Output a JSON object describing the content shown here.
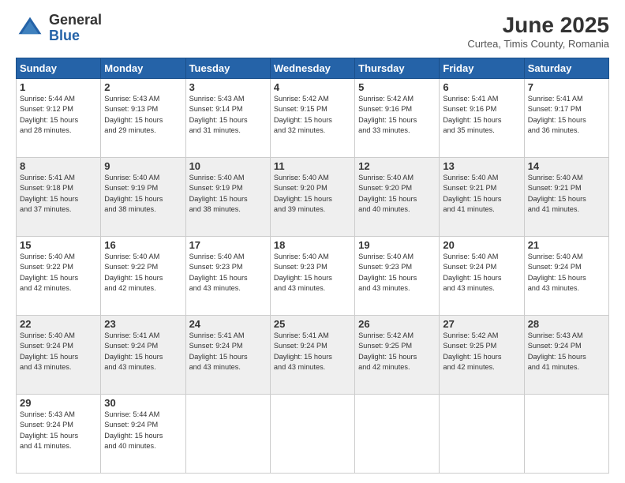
{
  "header": {
    "logo_general": "General",
    "logo_blue": "Blue",
    "month_title": "June 2025",
    "subtitle": "Curtea, Timis County, Romania"
  },
  "days_of_week": [
    "Sunday",
    "Monday",
    "Tuesday",
    "Wednesday",
    "Thursday",
    "Friday",
    "Saturday"
  ],
  "weeks": [
    [
      {
        "day": "1",
        "info": "Sunrise: 5:44 AM\nSunset: 9:12 PM\nDaylight: 15 hours\nand 28 minutes."
      },
      {
        "day": "2",
        "info": "Sunrise: 5:43 AM\nSunset: 9:13 PM\nDaylight: 15 hours\nand 29 minutes."
      },
      {
        "day": "3",
        "info": "Sunrise: 5:43 AM\nSunset: 9:14 PM\nDaylight: 15 hours\nand 31 minutes."
      },
      {
        "day": "4",
        "info": "Sunrise: 5:42 AM\nSunset: 9:15 PM\nDaylight: 15 hours\nand 32 minutes."
      },
      {
        "day": "5",
        "info": "Sunrise: 5:42 AM\nSunset: 9:16 PM\nDaylight: 15 hours\nand 33 minutes."
      },
      {
        "day": "6",
        "info": "Sunrise: 5:41 AM\nSunset: 9:16 PM\nDaylight: 15 hours\nand 35 minutes."
      },
      {
        "day": "7",
        "info": "Sunrise: 5:41 AM\nSunset: 9:17 PM\nDaylight: 15 hours\nand 36 minutes."
      }
    ],
    [
      {
        "day": "8",
        "info": "Sunrise: 5:41 AM\nSunset: 9:18 PM\nDaylight: 15 hours\nand 37 minutes."
      },
      {
        "day": "9",
        "info": "Sunrise: 5:40 AM\nSunset: 9:19 PM\nDaylight: 15 hours\nand 38 minutes."
      },
      {
        "day": "10",
        "info": "Sunrise: 5:40 AM\nSunset: 9:19 PM\nDaylight: 15 hours\nand 38 minutes."
      },
      {
        "day": "11",
        "info": "Sunrise: 5:40 AM\nSunset: 9:20 PM\nDaylight: 15 hours\nand 39 minutes."
      },
      {
        "day": "12",
        "info": "Sunrise: 5:40 AM\nSunset: 9:20 PM\nDaylight: 15 hours\nand 40 minutes."
      },
      {
        "day": "13",
        "info": "Sunrise: 5:40 AM\nSunset: 9:21 PM\nDaylight: 15 hours\nand 41 minutes."
      },
      {
        "day": "14",
        "info": "Sunrise: 5:40 AM\nSunset: 9:21 PM\nDaylight: 15 hours\nand 41 minutes."
      }
    ],
    [
      {
        "day": "15",
        "info": "Sunrise: 5:40 AM\nSunset: 9:22 PM\nDaylight: 15 hours\nand 42 minutes."
      },
      {
        "day": "16",
        "info": "Sunrise: 5:40 AM\nSunset: 9:22 PM\nDaylight: 15 hours\nand 42 minutes."
      },
      {
        "day": "17",
        "info": "Sunrise: 5:40 AM\nSunset: 9:23 PM\nDaylight: 15 hours\nand 43 minutes."
      },
      {
        "day": "18",
        "info": "Sunrise: 5:40 AM\nSunset: 9:23 PM\nDaylight: 15 hours\nand 43 minutes."
      },
      {
        "day": "19",
        "info": "Sunrise: 5:40 AM\nSunset: 9:23 PM\nDaylight: 15 hours\nand 43 minutes."
      },
      {
        "day": "20",
        "info": "Sunrise: 5:40 AM\nSunset: 9:24 PM\nDaylight: 15 hours\nand 43 minutes."
      },
      {
        "day": "21",
        "info": "Sunrise: 5:40 AM\nSunset: 9:24 PM\nDaylight: 15 hours\nand 43 minutes."
      }
    ],
    [
      {
        "day": "22",
        "info": "Sunrise: 5:40 AM\nSunset: 9:24 PM\nDaylight: 15 hours\nand 43 minutes."
      },
      {
        "day": "23",
        "info": "Sunrise: 5:41 AM\nSunset: 9:24 PM\nDaylight: 15 hours\nand 43 minutes."
      },
      {
        "day": "24",
        "info": "Sunrise: 5:41 AM\nSunset: 9:24 PM\nDaylight: 15 hours\nand 43 minutes."
      },
      {
        "day": "25",
        "info": "Sunrise: 5:41 AM\nSunset: 9:24 PM\nDaylight: 15 hours\nand 43 minutes."
      },
      {
        "day": "26",
        "info": "Sunrise: 5:42 AM\nSunset: 9:25 PM\nDaylight: 15 hours\nand 42 minutes."
      },
      {
        "day": "27",
        "info": "Sunrise: 5:42 AM\nSunset: 9:25 PM\nDaylight: 15 hours\nand 42 minutes."
      },
      {
        "day": "28",
        "info": "Sunrise: 5:43 AM\nSunset: 9:24 PM\nDaylight: 15 hours\nand 41 minutes."
      }
    ],
    [
      {
        "day": "29",
        "info": "Sunrise: 5:43 AM\nSunset: 9:24 PM\nDaylight: 15 hours\nand 41 minutes."
      },
      {
        "day": "30",
        "info": "Sunrise: 5:44 AM\nSunset: 9:24 PM\nDaylight: 15 hours\nand 40 minutes."
      },
      {
        "day": "",
        "info": ""
      },
      {
        "day": "",
        "info": ""
      },
      {
        "day": "",
        "info": ""
      },
      {
        "day": "",
        "info": ""
      },
      {
        "day": "",
        "info": ""
      }
    ]
  ]
}
